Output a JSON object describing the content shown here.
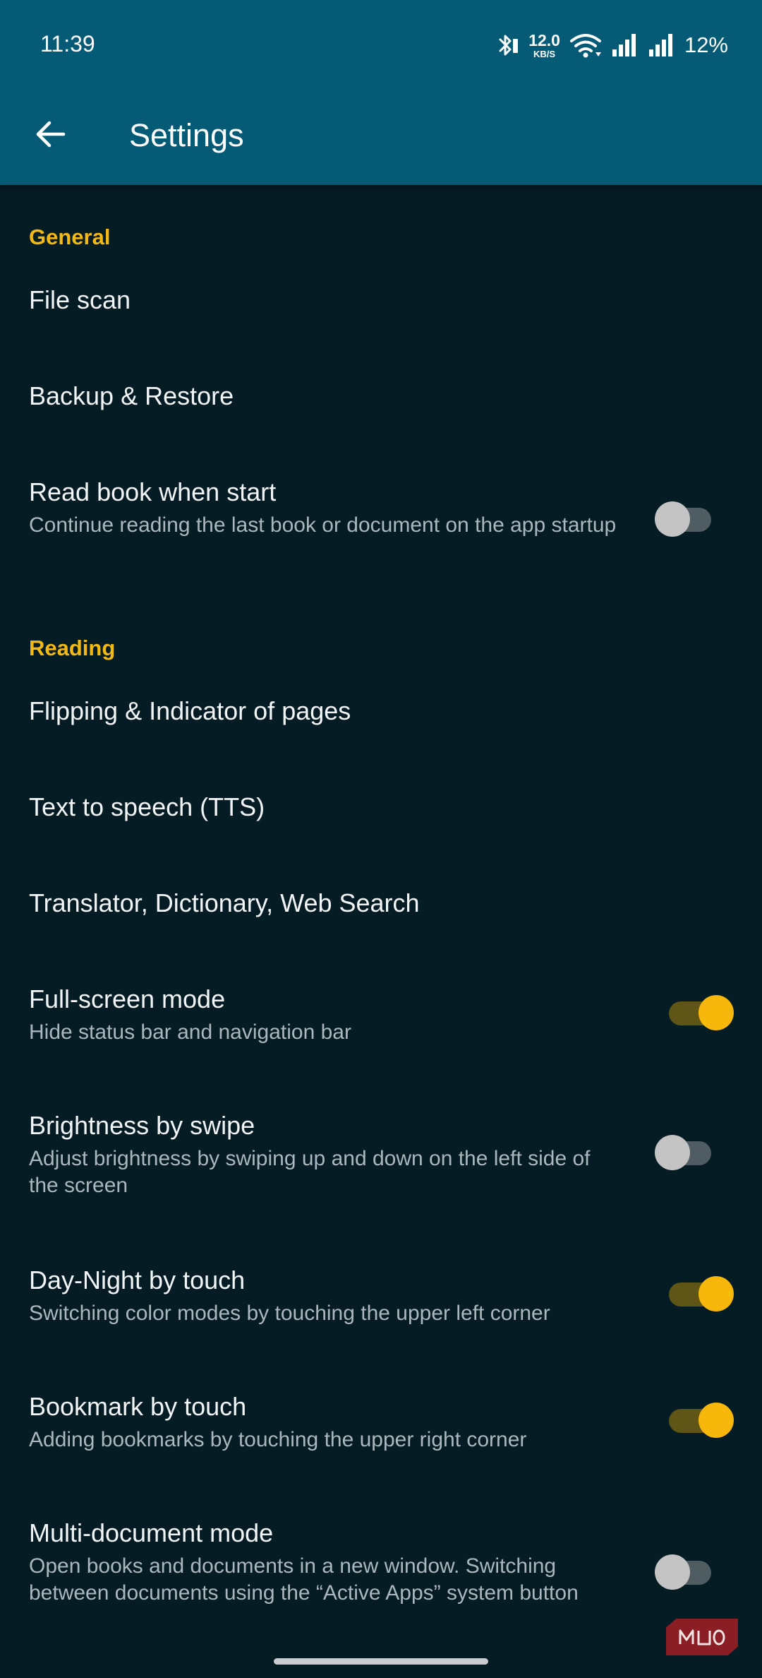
{
  "status_bar": {
    "time": "11:39",
    "net_speed_value": "12.0",
    "net_speed_unit": "KB/S",
    "battery": "12%"
  },
  "app_bar": {
    "title": "Settings"
  },
  "sections": {
    "general": "General",
    "reading": "Reading"
  },
  "items": {
    "file_scan": {
      "title": "File scan"
    },
    "backup_restore": {
      "title": "Backup & Restore"
    },
    "read_book_when_start": {
      "title": "Read book when start",
      "subtitle": "Continue reading the last book or document on the app startup",
      "enabled": false
    },
    "flipping_indicator": {
      "title": "Flipping & Indicator of pages"
    },
    "tts": {
      "title": "Text to speech (TTS)"
    },
    "translator": {
      "title": "Translator, Dictionary, Web Search"
    },
    "full_screen": {
      "title": "Full-screen mode",
      "subtitle": "Hide status bar and navigation bar",
      "enabled": true
    },
    "brightness_swipe": {
      "title": "Brightness by swipe",
      "subtitle": "Adjust brightness by swiping up and down on the left side of the screen",
      "enabled": false
    },
    "day_night_touch": {
      "title": "Day-Night by touch",
      "subtitle": "Switching color modes by touching the upper left corner",
      "enabled": true
    },
    "bookmark_touch": {
      "title": "Bookmark by touch",
      "subtitle": "Adding bookmarks by touching the upper right corner",
      "enabled": true
    },
    "multi_document": {
      "title": "Multi-document mode",
      "subtitle": "Open books and documents in a new window. Switching between documents using the “Active Apps” system button",
      "enabled": false
    }
  },
  "watermark": "MUO",
  "colors": {
    "app_bar": "#055a75",
    "background": "#061c24",
    "accent": "#f7b80b",
    "section_header": "#f2b914"
  },
  "icons": {
    "back": "arrow-left-icon",
    "bluetooth": "bluetooth-icon",
    "wifi": "wifi-icon",
    "signal": "cell-signal-icon"
  }
}
